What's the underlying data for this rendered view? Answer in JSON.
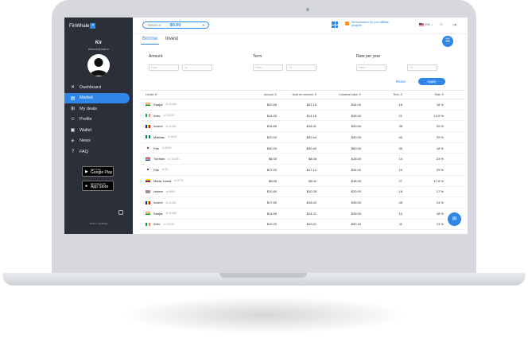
{
  "sidebar": {
    "logo": "FinWhale",
    "user_name": "Kir",
    "user_email": "kirbazar@mail.ru",
    "nav": [
      {
        "label": "Dashboard",
        "icon": "x-icon"
      },
      {
        "label": "Market",
        "icon": "market-icon",
        "active": true
      },
      {
        "label": "My deals",
        "icon": "deals-icon"
      },
      {
        "label": "Profile",
        "icon": "profile-icon"
      },
      {
        "label": "Wallet",
        "icon": "wallet-icon"
      },
      {
        "label": "News",
        "icon": "news-icon"
      },
      {
        "label": "FAQ",
        "icon": "faq-icon"
      }
    ],
    "google_play": {
      "small": "GET IT ON",
      "big": "Google Play"
    },
    "app_store": {
      "small": "Download on the",
      "big": "App Store"
    },
    "copyright": "2018 © FinWhale"
  },
  "topbar": {
    "balance_label": "Balance:",
    "balance_value": "$0.00",
    "affiliate_text": "Remuneration for your affiliate program",
    "language": "EN"
  },
  "tabs": [
    "Borrow",
    "Invest"
  ],
  "filters": {
    "amount": {
      "label": "Amount",
      "from": "From",
      "to": "To"
    },
    "term": {
      "label": "Term",
      "from": "From",
      "to": "To"
    },
    "rate": {
      "label": "Rate per year",
      "from": "From",
      "to": "To"
    },
    "reset": "Reset",
    "apply": "Apply"
  },
  "table": {
    "headers": [
      "Lender",
      "Amount",
      "Must be returned",
      "Collateral value",
      "Term",
      "Rate"
    ],
    "rows": [
      {
        "name": "Radjat",
        "id": "id 11465",
        "flag": "india",
        "amount": "$22.69",
        "returned": "$22.15",
        "collateral": "$44.00",
        "term": "16",
        "rate": "18 %"
      },
      {
        "name": "Artur",
        "id": "id 10424",
        "flag": "ireland",
        "amount": "$14.00",
        "returned": "$14.16",
        "collateral": "$28.00",
        "term": "21",
        "rate": "13.9 %"
      },
      {
        "name": "Andrei",
        "id": "id 11481",
        "flag": "romania",
        "amount": "$18.69",
        "returned": "$18.31",
        "collateral": "$30.00",
        "term": "35",
        "rate": "20 %"
      },
      {
        "name": "Mathias",
        "id": "id 9832",
        "flag": "nigeria",
        "amount": "$20.00",
        "returned": "$20.44",
        "collateral": "$40.00",
        "term": "40",
        "rate": "29 %"
      },
      {
        "name": "Pak",
        "id": "id 8340",
        "flag": "korea",
        "amount": "$30.00",
        "returned": "$30.40",
        "collateral": "$60.00",
        "term": "30",
        "rate": "18 %"
      },
      {
        "name": "Tordhan",
        "id": "id 11408",
        "flag": "netherlands",
        "amount": "$8.00",
        "returned": "$8.08",
        "collateral": "$18.00",
        "term": "14",
        "rate": "23 %"
      },
      {
        "name": "Pak",
        "id": "id 30",
        "flag": "korea",
        "amount": "$17.00",
        "returned": "$17.12",
        "collateral": "$34.00",
        "term": "10",
        "rate": "29 %"
      },
      {
        "name": "Marta Juana",
        "id": "id 8702",
        "flag": "colombia",
        "amount": "$8.69",
        "returned": "$8.11",
        "collateral": "$18.00",
        "term": "27",
        "rate": "17.8 %"
      },
      {
        "name": "chalee",
        "id": "id 6690",
        "flag": "thailand",
        "amount": "$10.69",
        "returned": "$10.26",
        "collateral": "$20.00",
        "term": "16",
        "rate": "17 %"
      },
      {
        "name": "Andrei",
        "id": "id 11481",
        "flag": "romania",
        "amount": "$17.50",
        "returned": "$18.02",
        "collateral": "$35.00",
        "term": "45",
        "rate": "24 %"
      },
      {
        "name": "Radjat",
        "id": "id 11465",
        "flag": "india",
        "amount": "$14.69",
        "returned": "$14.21",
        "collateral": "$28.00",
        "term": "13",
        "rate": "18 %"
      },
      {
        "name": "Artur",
        "id": "id 10424",
        "flag": "ireland",
        "amount": "$10.20",
        "returned": "$10.21",
        "collateral": "$20.42",
        "term": "11",
        "rate": "13 %"
      },
      {
        "name": "Marta Juana",
        "id": "id 8702",
        "flag": "colombia",
        "amount": "$18.69",
        "returned": "$18.75",
        "collateral": "$37.00",
        "term": "27",
        "rate": "23 %"
      }
    ]
  },
  "colors": {
    "accent": "#2f86e6",
    "sidebar": "#2b2f38",
    "gift": "#f7931e"
  }
}
